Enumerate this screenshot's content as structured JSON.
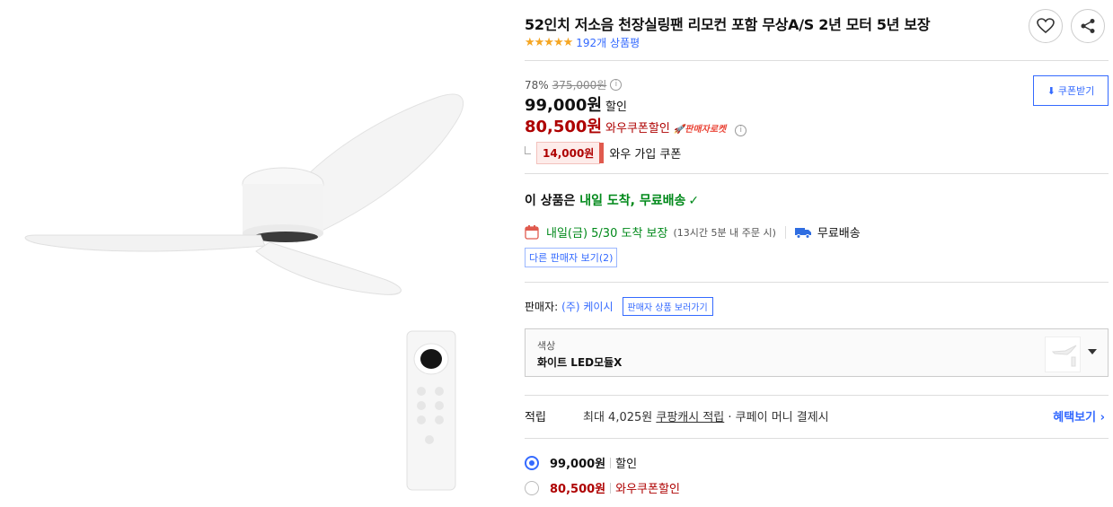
{
  "product": {
    "title": "52인치 저소음 천장실링팬 리모컨 포함 무상A/S 2년 모터 5년 보장",
    "rating_stars": "★★★★★",
    "review_count": "192개 상품평"
  },
  "pricing": {
    "discount_rate": "78%",
    "original_price": "375,000원",
    "sale_price": "99,000원",
    "sale_label": "할인",
    "wow_price": "80,500원",
    "wow_label": "와우쿠폰할인",
    "rocket_label": "판매자로켓",
    "wow_coupon_amount": "14,000원",
    "wow_coupon_label": "와우 가입 쿠폰",
    "coupon_button": "쿠폰받기"
  },
  "delivery": {
    "headline_prefix": "이 상품은 ",
    "headline_highlight": "내일 도착, 무료배송",
    "check": "✓",
    "date": "내일(금) 5/30 도착 보장",
    "cutoff": "(13시간 5분 내 주문 시)",
    "shipping": "무료배송",
    "other_sellers": "다른 판매자 보기(2)"
  },
  "seller": {
    "label": "판매자:",
    "name": "(주) 케이시",
    "link": "판매자 상품 보러가기"
  },
  "option": {
    "label": "색상",
    "value": "화이트 LED모듈X"
  },
  "reward": {
    "label": "적립",
    "text_prefix": "최대 4,025원 ",
    "text_link": "쿠팡캐시 적립",
    "text_suffix": " · 쿠페이 머니 결제시",
    "benefit": "혜택보기 ›"
  },
  "price_options": [
    {
      "price": "99,000원",
      "label": "할인",
      "selected": true
    },
    {
      "price": "80,500원",
      "label": "와우쿠폰할인",
      "selected": false
    }
  ],
  "colors": {
    "accent_blue": "#346aff",
    "price_red": "#ae0000",
    "delivery_green": "#00891a",
    "star": "#f5a623"
  }
}
